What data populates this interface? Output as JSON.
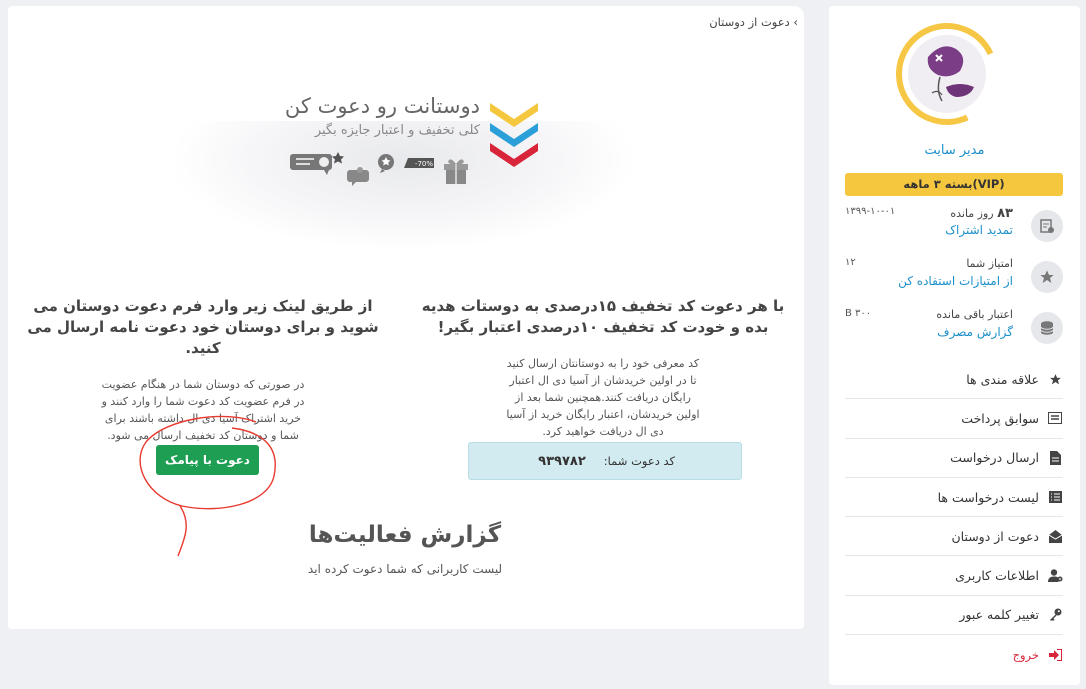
{
  "sidebar": {
    "user_name": "مدیر سایت",
    "package": "بسته ۳ ماهه(VIP)",
    "stats": [
      {
        "label_num": "۸۳",
        "label": "روز مانده",
        "link": "تمدید اشتراک",
        "value": "۱۳۹۹-۱۰-۰۱",
        "icon": "calendar-check-icon"
      },
      {
        "label": "امتیاز شما",
        "link": "از امتیازات استفاده کن",
        "value": "۱۲",
        "icon": "star-icon"
      },
      {
        "label": "اعتبار باقی مانده",
        "link": "گزارش مصرف",
        "value": "B ۳۰۰",
        "icon": "database-icon"
      }
    ],
    "menu": [
      {
        "label": "علاقه مندی ها",
        "icon": "star-icon"
      },
      {
        "label": "سوابق پرداخت",
        "icon": "receipt-icon"
      },
      {
        "label": "ارسال درخواست",
        "icon": "document-icon"
      },
      {
        "label": "لیست درخواست ها",
        "icon": "list-icon"
      },
      {
        "label": "دعوت از دوستان",
        "icon": "envelope-open-icon"
      },
      {
        "label": "اطلاعات کاربری",
        "icon": "user-cog-icon"
      },
      {
        "label": "تغییر کلمه عبور",
        "icon": "key-icon"
      },
      {
        "label": "خروج",
        "icon": "sign-out-icon"
      }
    ]
  },
  "tab": {
    "label": "دعوت از دوستان",
    "chevron": "›"
  },
  "hero": {
    "title": "دوستانت رو دعوت کن",
    "subtitle": "کلی تخفیف و اعتبار جایزه بگیر",
    "badge": "-70%"
  },
  "col_right": {
    "title": "با هر دعوت کد تخفیف ۱۵درصدی به دوستات هدیه بده و خودت کد تخفیف ۱۰درصدی اعتبار بگیر!",
    "text": "کد معرفی خود را به دوستانتان ارسال کنید تا در اولین خریدشان از آسیا دی ال اعتبار رایگان دریافت کنند.همچنین شما بعد از اولین خریدشان، اعتبار رایگان خرید از آسیا دی ال دریافت خواهید کرد.",
    "code_label": "کد دعوت شما:",
    "code_value": "۹۳۹۷۸۲"
  },
  "col_left": {
    "title": "از طریق لینک زیر وارد فرم دعوت دوستان می شوید و برای دوستان خود دعوت نامه ارسال می کنید.",
    "text": "در صورتی که دوستان شما در هنگام عضویت در فرم عضویت کد دعوت شما را وارد کنند و خرید اشتراک آسیا دی ال داشته باشند برای شما و دوستان کد تخفیف ارسال می شود.",
    "button": "دعوت با پیامک"
  },
  "report": {
    "title": "گزارش فعالیت‌ها",
    "subtitle": "لیست کاربرانی که شما دعوت کرده اید"
  },
  "colors": {
    "accent_blue": "#1c8fc9",
    "vip_yellow": "#f5c73f",
    "button_green": "#1e9e53",
    "logout_red": "#d9253a",
    "code_box": "#d2ebf0",
    "annotation_red": "#e8392f"
  }
}
